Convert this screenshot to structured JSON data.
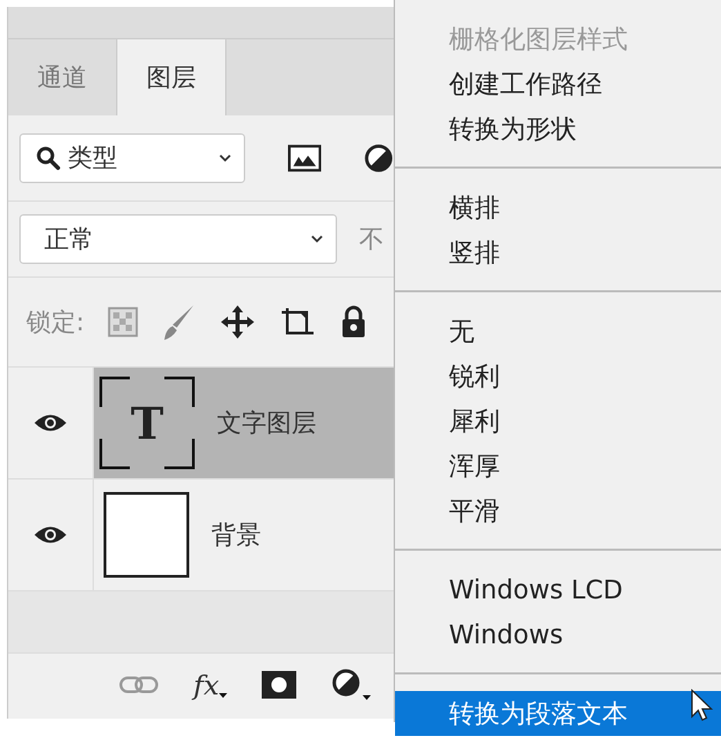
{
  "panel": {
    "tabs": [
      {
        "label": "通道",
        "selected": false
      },
      {
        "label": "图层",
        "selected": true
      }
    ],
    "filter": {
      "value": "类型"
    },
    "blend_mode": {
      "value": "正常"
    },
    "opacity_label": "不",
    "lock_label": "锁定:",
    "layers": [
      {
        "name": "文字图层",
        "kind": "text",
        "thumb_text": "T",
        "visible": true,
        "selected": true
      },
      {
        "name": "背景",
        "kind": "fill",
        "visible": true,
        "selected": false
      }
    ],
    "toolbar_fx": "fx"
  },
  "menu": {
    "groups": [
      [
        {
          "label": "栅格化图层样式",
          "disabled": true,
          "selected": false
        },
        {
          "label": "创建工作路径",
          "disabled": false,
          "selected": false
        },
        {
          "label": "转换为形状",
          "disabled": false,
          "selected": false
        }
      ],
      [
        {
          "label": "横排",
          "disabled": false,
          "selected": false
        },
        {
          "label": "竖排",
          "disabled": false,
          "selected": false
        }
      ],
      [
        {
          "label": "无",
          "disabled": false,
          "selected": false
        },
        {
          "label": "锐利",
          "disabled": false,
          "selected": false
        },
        {
          "label": "犀利",
          "disabled": false,
          "selected": false
        },
        {
          "label": "浑厚",
          "disabled": false,
          "selected": false
        },
        {
          "label": "平滑",
          "disabled": false,
          "selected": false
        }
      ],
      [
        {
          "label": "Windows LCD",
          "disabled": false,
          "selected": false
        },
        {
          "label": "Windows",
          "disabled": false,
          "selected": false
        }
      ],
      [
        {
          "label": "转换为段落文本",
          "disabled": false,
          "selected": true
        }
      ]
    ]
  }
}
